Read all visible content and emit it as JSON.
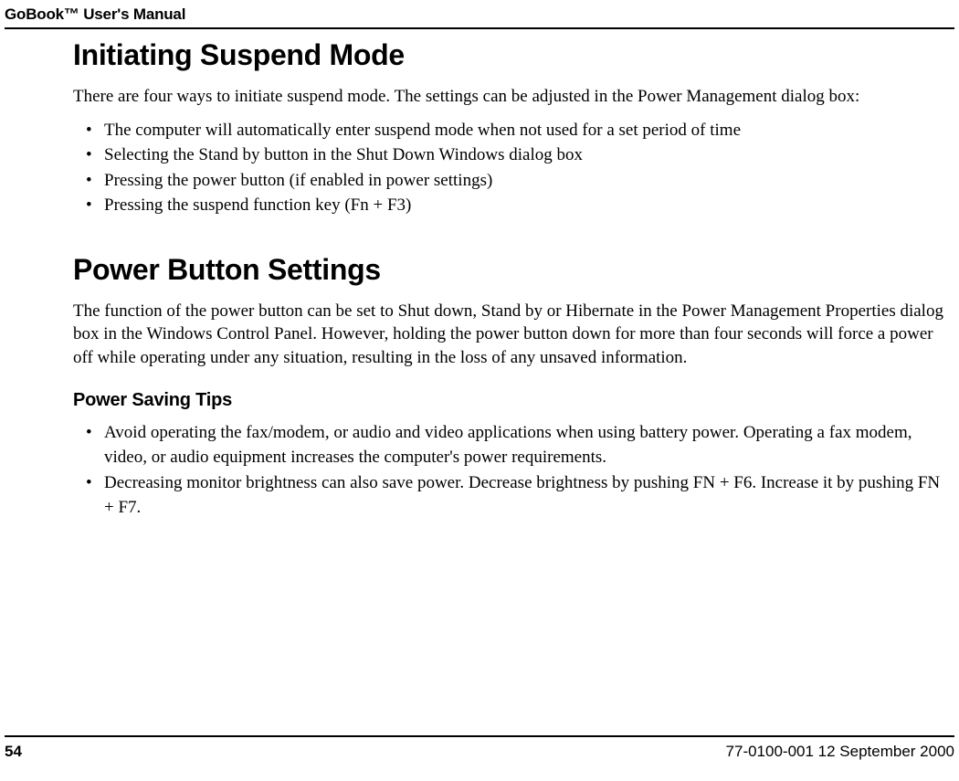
{
  "header": {
    "title": "GoBook™ User's Manual"
  },
  "sections": {
    "s1": {
      "heading": "Initiating Suspend Mode",
      "intro": "There are four ways to initiate suspend mode. The settings can be adjusted in the Power Management dialog box:",
      "bullets": [
        "The computer will automatically enter suspend mode when not used for a set period of time",
        "Selecting the Stand by button in the Shut Down Windows dialog box",
        "Pressing the power button (if enabled in power settings)",
        "Pressing the suspend function key (Fn + F3)"
      ]
    },
    "s2": {
      "heading": "Power Button Settings",
      "intro": "The function of the power button can be set to Shut down, Stand by or Hibernate in the Power Management Properties dialog box in the Windows Control Panel. However, holding the power button down for more than four seconds will force a power off while operating under any situation, resulting in the loss of any unsaved information.",
      "sub": {
        "heading": "Power Saving Tips",
        "bullets": [
          "Avoid operating the fax/modem, or audio and video applications when using battery power. Operating a fax modem, video, or audio equipment increases the computer's power requirements.",
          "Decreasing monitor brightness can also save power. Decrease brightness by pushing FN + F6. Increase it by pushing FN + F7."
        ]
      }
    }
  },
  "footer": {
    "page": "54",
    "docdate": "77-0100-001   12 September 2000"
  }
}
